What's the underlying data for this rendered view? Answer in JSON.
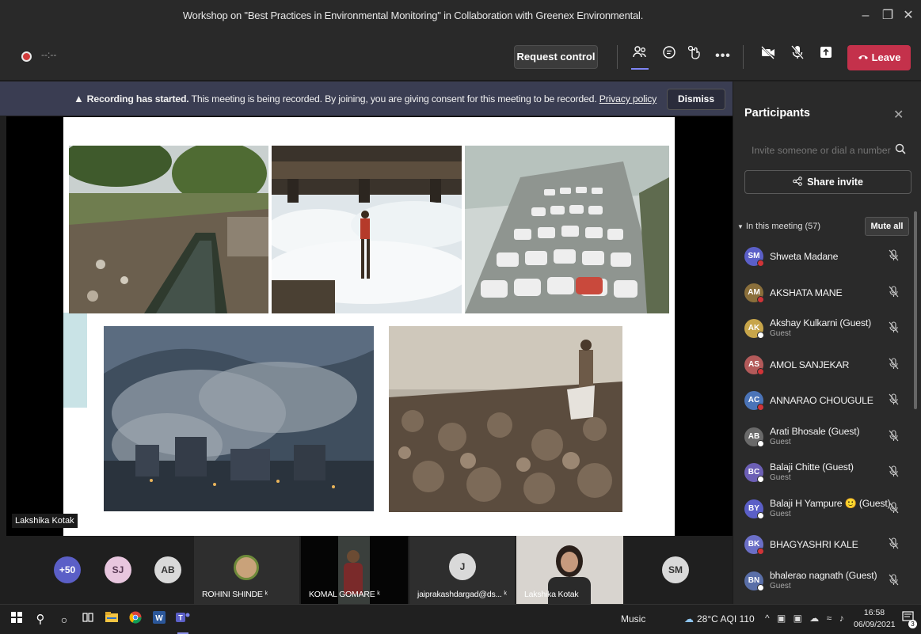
{
  "window": {
    "title": "Workshop on \"Best Practices in Environmental Monitoring\" in Collaboration with Greenex Environmental."
  },
  "toolbar": {
    "timer": "--:--",
    "request_control": "Request control",
    "leave": "Leave"
  },
  "banner": {
    "bold": "Recording has started.",
    "text": " This meeting is being recorded. By joining, you are giving consent for this meeting to be recorded. ",
    "link": "Privacy policy",
    "dismiss": "Dismiss"
  },
  "stage": {
    "presenter_label": "Lakshika Kotak"
  },
  "participants_pane": {
    "title": "Participants",
    "invite_placeholder": "Invite someone or dial a number",
    "share_invite": "Share invite",
    "in_meeting": "In this meeting (57)",
    "mute_all": "Mute all",
    "people": [
      {
        "initials": "SM",
        "name": "Shweta Madane",
        "sub": "",
        "color": "#5b5fc7"
      },
      {
        "initials": "AM",
        "name": "AKSHATA MANE",
        "sub": "",
        "color": "#8a6f3b"
      },
      {
        "initials": "AK",
        "name": "Akshay Kulkarni (Guest)",
        "sub": "Guest",
        "color": "#c7a54a"
      },
      {
        "initials": "AS",
        "name": "AMOL SANJEKAR",
        "sub": "",
        "color": "#b35a5a"
      },
      {
        "initials": "AC",
        "name": "ANNARAO CHOUGULE",
        "sub": "",
        "color": "#4b74b8"
      },
      {
        "initials": "AB",
        "name": "Arati Bhosale (Guest)",
        "sub": "Guest",
        "color": "#6a6a6a"
      },
      {
        "initials": "BC",
        "name": "Balaji Chitte (Guest)",
        "sub": "Guest",
        "color": "#6c5fb5"
      },
      {
        "initials": "BY",
        "name": "Balaji H Yampure 🙂 (Guest)",
        "sub": "Guest",
        "color": "#5b5fc7"
      },
      {
        "initials": "BK",
        "name": "BHAGYASHRI KALE",
        "sub": "",
        "color": "#6b6fc7"
      },
      {
        "initials": "BN",
        "name": "bhalerao nagnath (Guest)",
        "sub": "Guest",
        "color": "#5a6fa8"
      }
    ]
  },
  "gallery": {
    "overflow": "+50",
    "avatars": [
      "SJ",
      "AB"
    ],
    "tiles": [
      {
        "label": "ROHINI SHINDE"
      },
      {
        "label": "KOMAL GOMARE"
      },
      {
        "label": "jaiprakashdargad@ds...",
        "initial": "J"
      },
      {
        "label": "Lakshika Kotak"
      }
    ],
    "last": "SM"
  },
  "taskbar": {
    "music": "Music",
    "weather": "28°C AQI 110",
    "time": "16:58",
    "date": "06/09/2021",
    "notif_count": "3"
  }
}
